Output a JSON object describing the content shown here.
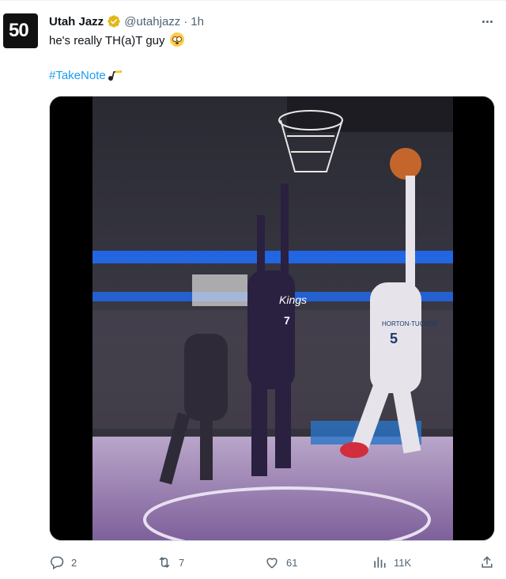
{
  "author": {
    "avatar_text": "50",
    "name": "Utah Jazz",
    "handle": "@utahjazz",
    "separator": "·",
    "time": "1h"
  },
  "tweet": {
    "text": "he's really TH(a)T guy",
    "hashtag": "#TakeNote"
  },
  "media": {
    "jersey_kings_number": "7",
    "jersey_kings_text": "Kings",
    "jersey_jazz_number": "5",
    "jersey_jazz_name": "HORTON-TUCKER"
  },
  "actions": {
    "replies": "2",
    "retweets": "7",
    "likes": "61",
    "views": "11K"
  },
  "icons": {
    "more": "more-dots-icon",
    "verified": "verified-badge-icon",
    "reply": "reply-icon",
    "retweet": "retweet-icon",
    "like": "heart-icon",
    "views": "views-chart-icon",
    "share": "share-icon"
  },
  "colors": {
    "link": "#1d9bf0",
    "muted": "#536471",
    "verified": "#e2b719",
    "kings_purple": "#5a2d81",
    "court_blue": "#1e6fff"
  }
}
